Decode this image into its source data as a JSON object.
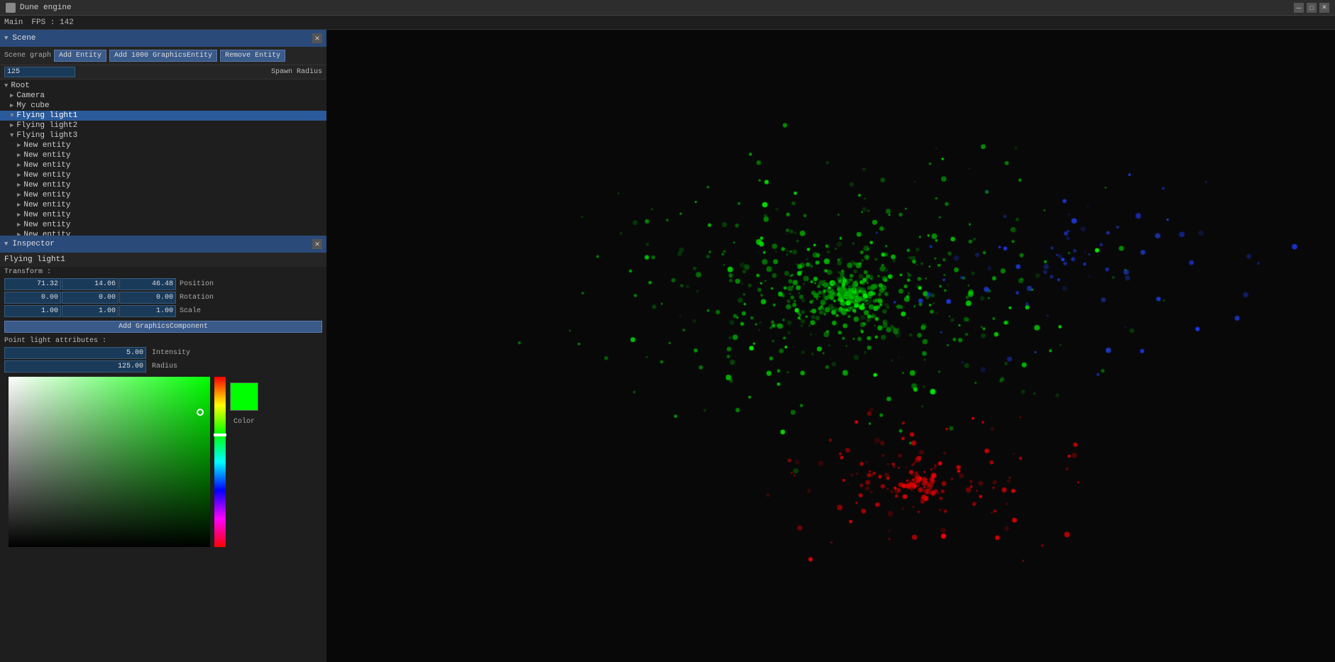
{
  "titlebar": {
    "title": "Dune engine",
    "icon": "engine-icon"
  },
  "menubar": {
    "items": [
      "Main",
      "FPS : 142"
    ]
  },
  "scene_panel": {
    "title": "Scene",
    "buttons": {
      "add_entity": "Add Entity",
      "add_1000": "Add 1000 GraphicsEntity",
      "remove_entity": "Remove Entity"
    },
    "spawn_radius_value": "125",
    "spawn_radius_label": "Spawn Radius"
  },
  "scene_tree": {
    "items": [
      {
        "label": "Root",
        "indent": 0,
        "arrow": "▼",
        "selected": false
      },
      {
        "label": "Camera",
        "indent": 1,
        "arrow": "▶",
        "selected": false
      },
      {
        "label": "My cube",
        "indent": 1,
        "arrow": "▶",
        "selected": false
      },
      {
        "label": "Flying light1",
        "indent": 1,
        "arrow": "▼",
        "selected": true
      },
      {
        "label": "Flying light2",
        "indent": 1,
        "arrow": "▶",
        "selected": false
      },
      {
        "label": "Flying light3",
        "indent": 1,
        "arrow": "▼",
        "selected": false
      },
      {
        "label": "New entity",
        "indent": 2,
        "arrow": "▶",
        "selected": false
      },
      {
        "label": "New entity",
        "indent": 2,
        "arrow": "▶",
        "selected": false
      },
      {
        "label": "New entity",
        "indent": 2,
        "arrow": "▶",
        "selected": false
      },
      {
        "label": "New entity",
        "indent": 2,
        "arrow": "▶",
        "selected": false
      },
      {
        "label": "New entity",
        "indent": 2,
        "arrow": "▶",
        "selected": false
      },
      {
        "label": "New entity",
        "indent": 2,
        "arrow": "▶",
        "selected": false
      },
      {
        "label": "New entity",
        "indent": 2,
        "arrow": "▶",
        "selected": false
      },
      {
        "label": "New entity",
        "indent": 2,
        "arrow": "▶",
        "selected": false
      },
      {
        "label": "New entity",
        "indent": 2,
        "arrow": "▶",
        "selected": false
      },
      {
        "label": "New entity",
        "indent": 2,
        "arrow": "▶",
        "selected": false
      }
    ]
  },
  "inspector_panel": {
    "title": "Inspector",
    "entity_name": "Flying light1",
    "transform_label": "Transform :",
    "position": {
      "x": "71.32",
      "y": "14.06",
      "z": "46.48",
      "label": "Position"
    },
    "rotation": {
      "x": "0.00",
      "y": "0.00",
      "z": "0.00",
      "label": "Rotation"
    },
    "scale": {
      "x": "1.00",
      "y": "1.00",
      "z": "1.00",
      "label": "Scale"
    },
    "add_component_btn": "Add GraphicsComponent",
    "point_light_label": "Point light attributes :",
    "intensity": {
      "value": "5.00",
      "label": "Intensity"
    },
    "radius": {
      "value": "125.00",
      "label": "Radius"
    },
    "color_label": "Color",
    "color_value": "#00ff00"
  },
  "viewport": {
    "bg_color": "#080808"
  }
}
